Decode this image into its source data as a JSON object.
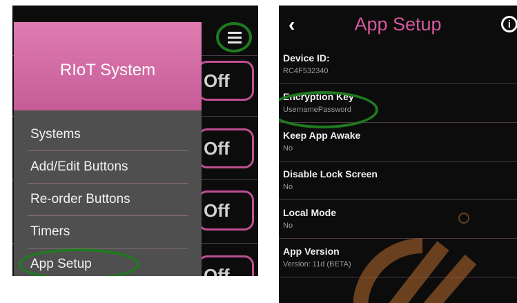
{
  "left_panel": {
    "drawer_title": "RIoT System",
    "menu_items": [
      {
        "label": "Systems"
      },
      {
        "label": "Add/Edit Buttons"
      },
      {
        "label": "Re-order Buttons"
      },
      {
        "label": "Timers"
      },
      {
        "label": "App Setup"
      }
    ],
    "background_buttons": [
      {
        "label": "Off"
      },
      {
        "label": "Off"
      },
      {
        "label": "Off"
      },
      {
        "label": "Off"
      }
    ],
    "menu_icon": "hamburger-menu-icon"
  },
  "right_panel": {
    "back_icon": "chevron-left-icon",
    "title": "App Setup",
    "info_icon": "info-icon",
    "settings": [
      {
        "title": "Device ID:",
        "value": "RC4F532340"
      },
      {
        "title": "Encryption Key",
        "value": "UsernamePassword"
      },
      {
        "title": "Keep App Awake",
        "value": "No"
      },
      {
        "title": "Disable Lock Screen",
        "value": "No"
      },
      {
        "title": "Local Mode",
        "value": "No"
      },
      {
        "title": "App Version",
        "value": "Version: 11d (BETA)"
      }
    ]
  },
  "colors": {
    "accent_pink": "#d5589c",
    "drawer_header": "#d06aa4",
    "highlight_circle": "#1f7a1f",
    "background": "#0c0c0c"
  }
}
